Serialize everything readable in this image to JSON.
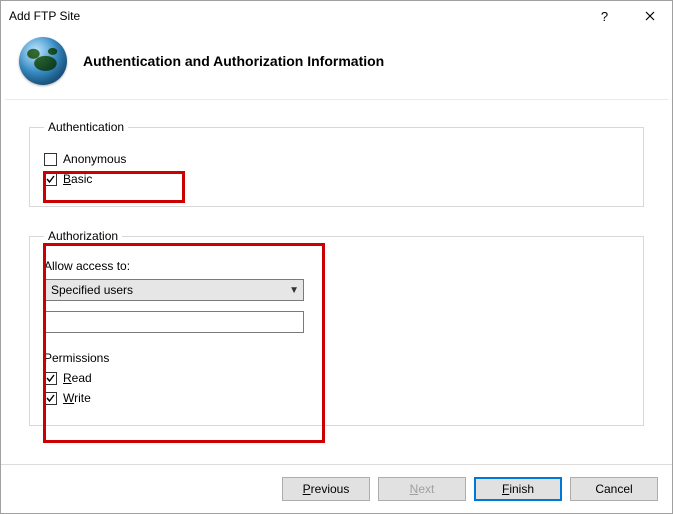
{
  "window": {
    "title": "Add FTP Site"
  },
  "header": {
    "heading": "Authentication and Authorization Information"
  },
  "authentication": {
    "legend": "Authentication",
    "anonymous": {
      "label_pre": "A",
      "label_rest": "nonymous",
      "checked": false
    },
    "basic": {
      "label_pre": "B",
      "label_rest": "asic",
      "checked": true
    }
  },
  "authorization": {
    "legend": "Authorization",
    "allow_label": "Allow access to:",
    "select_value": "Specified users",
    "input_value": "",
    "permissions_label": "Permissions",
    "read": {
      "label_pre": "R",
      "label_rest": "ead",
      "checked": true
    },
    "write": {
      "label_pre": "W",
      "label_rest": "rite",
      "checked": true
    }
  },
  "buttons": {
    "previous_pre": "P",
    "previous_rest": "revious",
    "next_pre": "N",
    "next_rest": "ext",
    "finish_pre": "F",
    "finish_rest": "inish",
    "cancel": "Cancel"
  }
}
